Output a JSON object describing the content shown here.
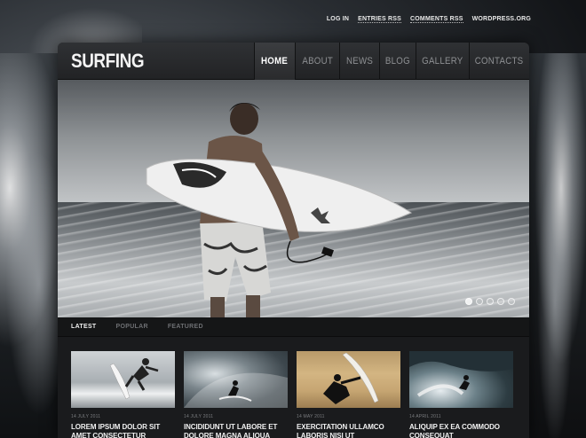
{
  "top_links": [
    {
      "label": "LOG IN"
    },
    {
      "label": "ENTRIES RSS"
    },
    {
      "label": "COMMENTS RSS"
    },
    {
      "label": "WORDPRESS.ORG"
    }
  ],
  "header": {
    "logo": "SURFING",
    "nav": [
      {
        "label": "HOME",
        "active": true
      },
      {
        "label": "ABOUT"
      },
      {
        "label": "NEWS"
      },
      {
        "label": "BLOG"
      },
      {
        "label": "GALLERY"
      },
      {
        "label": "CONTACTS"
      }
    ]
  },
  "tabs": [
    {
      "label": "LATEST",
      "active": true
    },
    {
      "label": "POPULAR"
    },
    {
      "label": "FEATURED"
    }
  ],
  "posts": [
    {
      "date": "14 JULY 2011",
      "title": "LOREM IPSUM DOLOR SIT AMET CONSECTETUR"
    },
    {
      "date": "14 JULY 2011",
      "title": "INCIDIDUNT UT LABORE ET DOLORE MAGNA ALIQUA"
    },
    {
      "date": "14 MAY 2011",
      "title": "EXERCITATION ULLAMCO LABORIS NISI UT"
    },
    {
      "date": "14 APRIL 2011",
      "title": "ALIQUIP EX EA COMMODO CONSEQUAT"
    }
  ]
}
